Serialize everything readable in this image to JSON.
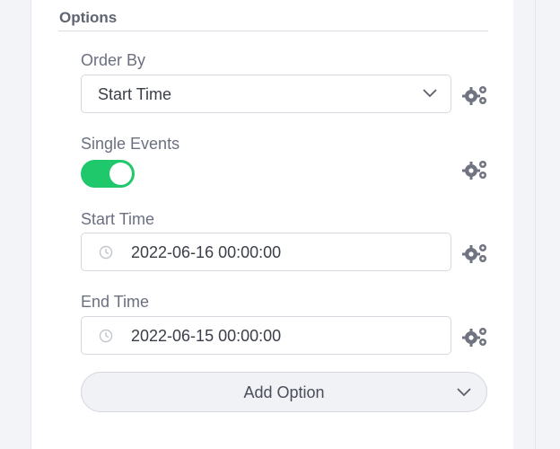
{
  "options": {
    "section_title": "Options",
    "order_by": {
      "label": "Order By",
      "selected": "Start Time"
    },
    "single_events": {
      "label": "Single Events",
      "enabled": true
    },
    "start_time": {
      "label": "Start Time",
      "value": "2022-06-16 00:00:00"
    },
    "end_time": {
      "label": "End Time",
      "value": "2022-06-15 00:00:00"
    },
    "add_option": {
      "label": "Add Option"
    }
  },
  "colors": {
    "toggle_on": "#1fc86a",
    "gear": "#6f7480",
    "label": "#6b7080"
  },
  "icons": {
    "settings": "gears-icon",
    "dropdown": "chevron-down-icon",
    "time": "clock-icon"
  }
}
